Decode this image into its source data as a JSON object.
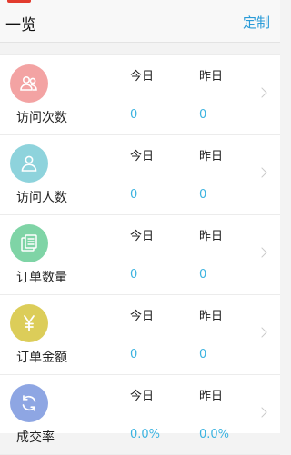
{
  "header": {
    "title": "一览",
    "action_label": "定制"
  },
  "colors": {
    "accent": "#2a9bd8",
    "value": "#3bb3e0"
  },
  "metrics": [
    {
      "label": "访问次数",
      "today_header": "今日",
      "yesterday_header": "昨日",
      "today_value": "0",
      "yesterday_value": "0",
      "icon": "visitors-group-icon",
      "icon_color": "#f3a3a3"
    },
    {
      "label": "访问人数",
      "today_header": "今日",
      "yesterday_header": "昨日",
      "today_value": "0",
      "yesterday_value": "0",
      "icon": "person-icon",
      "icon_color": "#8ed3dc"
    },
    {
      "label": "订单数量",
      "today_header": "今日",
      "yesterday_header": "昨日",
      "today_value": "0",
      "yesterday_value": "0",
      "icon": "order-list-icon",
      "icon_color": "#7fd4a6"
    },
    {
      "label": "订单金额",
      "today_header": "今日",
      "yesterday_header": "昨日",
      "today_value": "0",
      "yesterday_value": "0",
      "icon": "yen-icon",
      "icon_color": "#dccd59"
    },
    {
      "label": "成交率",
      "today_header": "今日",
      "yesterday_header": "昨日",
      "today_value": "0.0%",
      "yesterday_value": "0.0%",
      "icon": "refresh-cycle-icon",
      "icon_color": "#8ea6e3"
    }
  ]
}
